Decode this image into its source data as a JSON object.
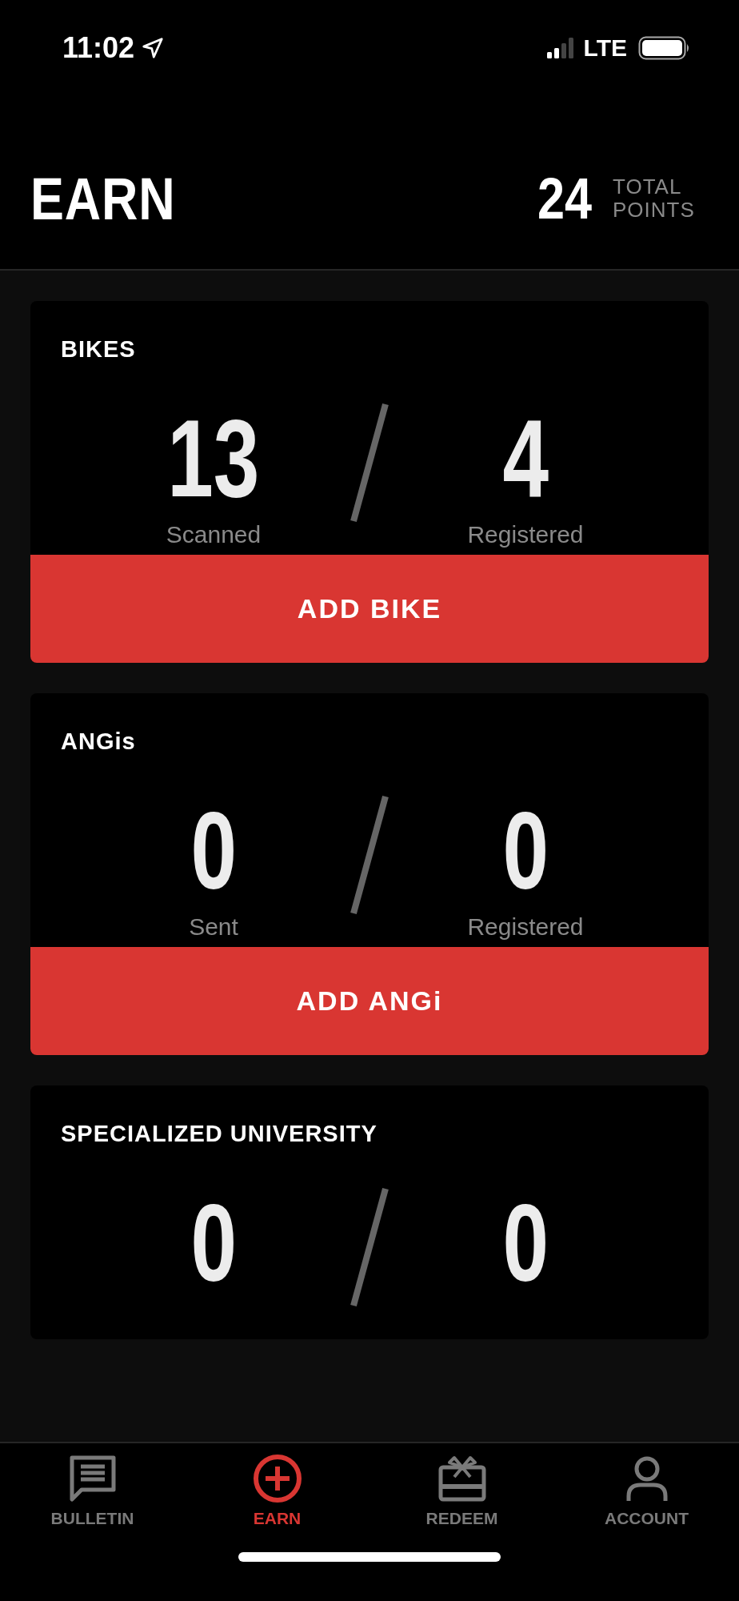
{
  "status_bar": {
    "time": "11:02",
    "network": "LTE"
  },
  "header": {
    "title": "EARN",
    "points": "24",
    "points_label": "TOTAL POINTS"
  },
  "cards": [
    {
      "title": "BIKES",
      "stats": [
        {
          "value": "13",
          "label": "Scanned"
        },
        {
          "value": "4",
          "label": "Registered"
        }
      ],
      "button": "ADD BIKE"
    },
    {
      "title": "ANGis",
      "stats": [
        {
          "value": "0",
          "label": "Sent"
        },
        {
          "value": "0",
          "label": "Registered"
        }
      ],
      "button": "ADD ANGi"
    },
    {
      "title": "SPECIALIZED UNIVERSITY",
      "stats": [
        {
          "value": "0"
        },
        {
          "value": "0"
        }
      ]
    }
  ],
  "tabs": [
    {
      "kind": "bulletin",
      "label": "BULLETIN",
      "selected": false
    },
    {
      "kind": "earn",
      "label": "EARN",
      "selected": true
    },
    {
      "kind": "redeem",
      "label": "REDEEM",
      "selected": false
    },
    {
      "kind": "account",
      "label": "ACCOUNT",
      "selected": false
    }
  ]
}
